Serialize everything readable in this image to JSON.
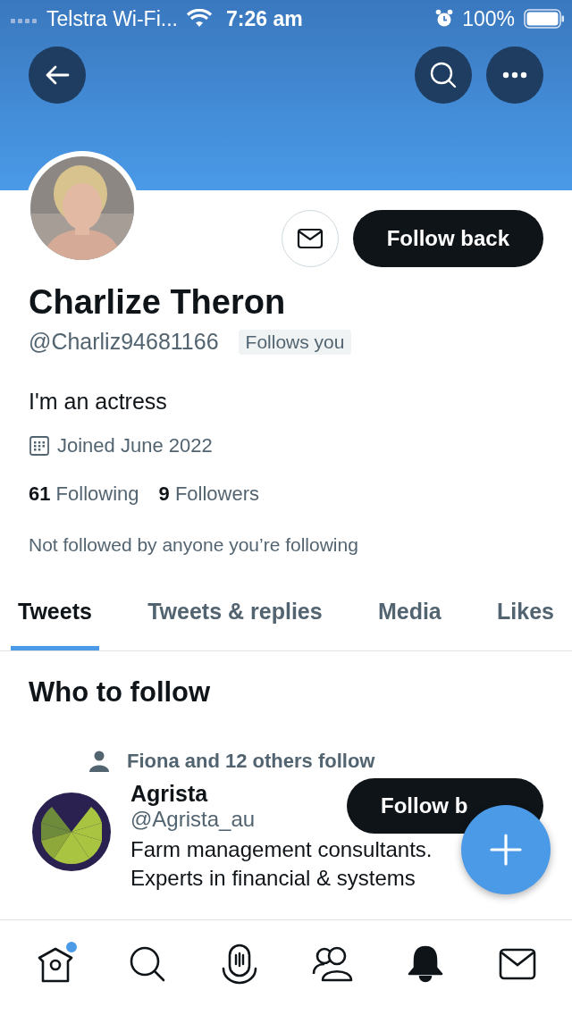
{
  "status_bar": {
    "carrier": "Telstra Wi-Fi...",
    "time": "7:26 am",
    "battery": "100%"
  },
  "profile": {
    "name": "Charlize Theron",
    "handle": "@Charliz94681166",
    "follows_you": "Follows you",
    "bio": "I'm an actress",
    "joined": "Joined June 2022",
    "following_count": "61",
    "following_label": "Following",
    "followers_count": "9",
    "followers_label": "Followers",
    "followed_by_note": "Not followed by anyone you’re following",
    "follow_button": "Follow back"
  },
  "tabs": [
    {
      "label": "Tweets",
      "selected": true
    },
    {
      "label": "Tweets & replies",
      "selected": false
    },
    {
      "label": "Media",
      "selected": false
    },
    {
      "label": "Likes",
      "selected": false
    }
  ],
  "who_to_follow": {
    "title": "Who to follow",
    "suggestions": [
      {
        "social_context": "Fiona and 12 others follow",
        "name": "Agrista",
        "handle": "@Agrista_au",
        "follow_button": "Follow b",
        "bio_lines": [
          "Farm management consultants.",
          "Experts in financial & systems"
        ]
      }
    ]
  },
  "bottom_nav": [
    {
      "kind": "home",
      "selected": false,
      "badge": true
    },
    {
      "kind": "search",
      "selected": false,
      "badge": false
    },
    {
      "kind": "spaces",
      "selected": false,
      "badge": false
    },
    {
      "kind": "communities",
      "selected": false,
      "badge": false
    },
    {
      "kind": "notifications",
      "selected": true,
      "badge": false
    },
    {
      "kind": "messages",
      "selected": false,
      "badge": false
    }
  ]
}
